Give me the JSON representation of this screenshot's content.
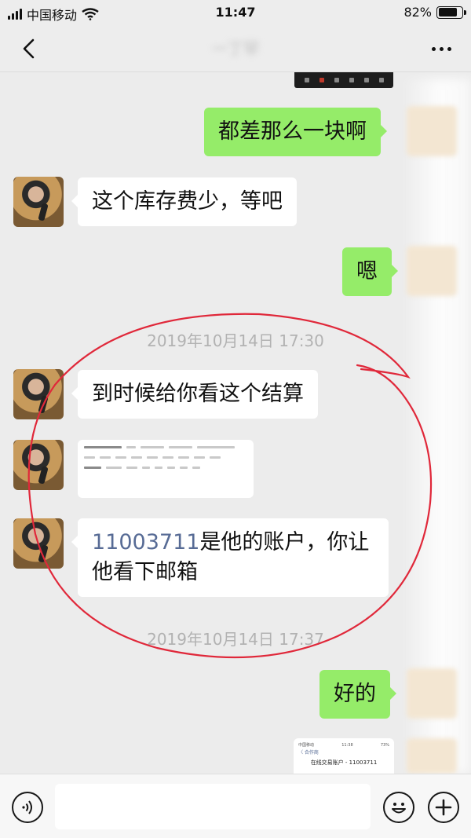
{
  "status_bar": {
    "carrier": "中国移动",
    "time": "11:47",
    "battery_pct": "82%",
    "battery_level": 0.82
  },
  "nav": {
    "title": "一丁罕",
    "back_icon": "chevron-left-icon",
    "more_icon": "more-dots-icon"
  },
  "messages": [
    {
      "side": "out",
      "text": "都差那么一块啊"
    },
    {
      "side": "in",
      "text": "这个库存费少，等吧"
    },
    {
      "side": "out",
      "text": "嗯"
    },
    {
      "type": "time",
      "text": "2019年10月14日 17:30"
    },
    {
      "side": "in",
      "text": "到时候给你看这个结算"
    },
    {
      "side": "in",
      "type": "image"
    },
    {
      "side": "in",
      "link_text": "11003711",
      "text_line1": "是他的账户，你让",
      "text_line2": "他看下邮箱"
    },
    {
      "type": "time",
      "text": "2019年10月14日 17:37"
    },
    {
      "side": "out",
      "text": "好的"
    },
    {
      "side": "out",
      "type": "image"
    }
  ],
  "thumbnail": {
    "status_left": "中国移动",
    "status_time": "11:38",
    "status_right": "73%",
    "nav_back": "〈 合作商",
    "title": "在线交易账户 - 11003711"
  },
  "input_bar": {
    "placeholder": "",
    "voice_icon": "voice-icon",
    "emoji_icon": "emoji-icon",
    "plus_icon": "plus-icon"
  },
  "colors": {
    "outgoing_bubble": "#95ec69",
    "incoming_bubble": "#ffffff",
    "background": "#ececec",
    "annotation": "#e0283a",
    "link": "#576b95"
  }
}
